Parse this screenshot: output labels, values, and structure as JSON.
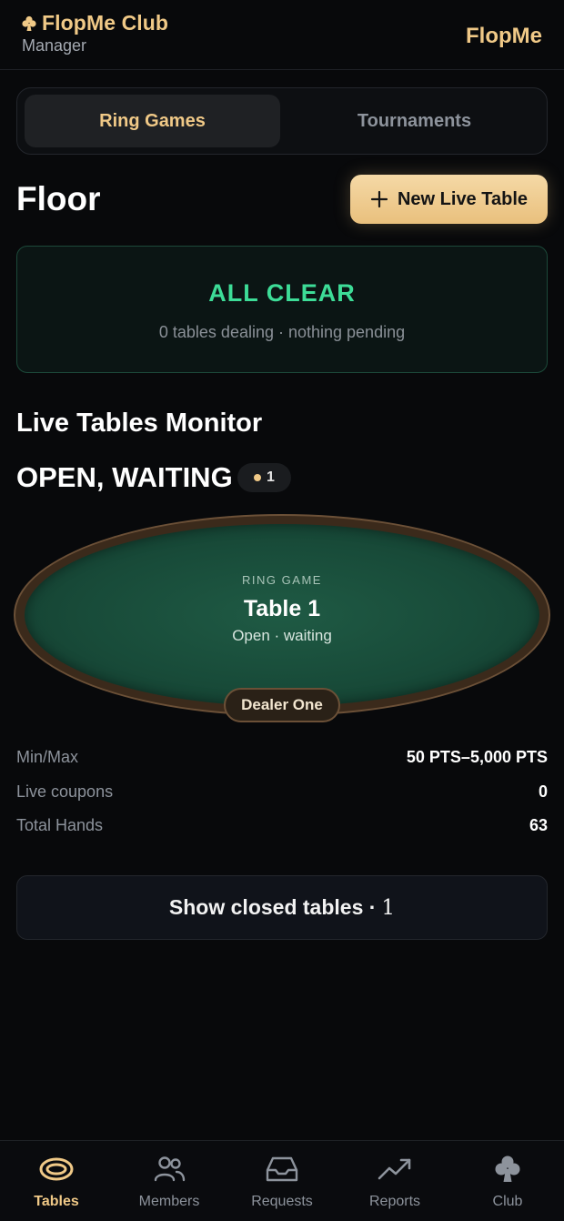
{
  "header": {
    "club_name": "FlopMe Club",
    "role": "Manager",
    "logo_text": "FlopMe"
  },
  "segmented": {
    "active": "Ring Games",
    "inactive": "Tournaments"
  },
  "floor": {
    "title": "Floor",
    "new_table_label": "New Live Table"
  },
  "status_card": {
    "title": "ALL CLEAR",
    "subtitle": "0 tables dealing · nothing pending"
  },
  "monitor": {
    "title": "Live Tables Monitor",
    "group_title": "OPEN, WAITING",
    "group_count": "1"
  },
  "table": {
    "type": "RING GAME",
    "name": "Table 1",
    "status": "Open · waiting",
    "dealer": "Dealer One",
    "stats": [
      {
        "label": "Min/Max",
        "value": "50 PTS–5,000 PTS"
      },
      {
        "label": "Live coupons",
        "value": "0"
      },
      {
        "label": "Total Hands",
        "value": "63"
      }
    ]
  },
  "closed": {
    "label": "Show closed tables ·",
    "count": "1"
  },
  "tabbar": {
    "items": [
      {
        "label": "Tables",
        "icon": "table-icon"
      },
      {
        "label": "Members",
        "icon": "members-icon"
      },
      {
        "label": "Requests",
        "icon": "inbox-icon"
      },
      {
        "label": "Reports",
        "icon": "trend-icon"
      },
      {
        "label": "Club",
        "icon": "club-suit-icon"
      }
    ],
    "active_index": 0
  },
  "colors": {
    "accent": "#f0c987",
    "success": "#3ddc97",
    "felt": "#1f5a44",
    "rail": "#3b2a1b"
  }
}
